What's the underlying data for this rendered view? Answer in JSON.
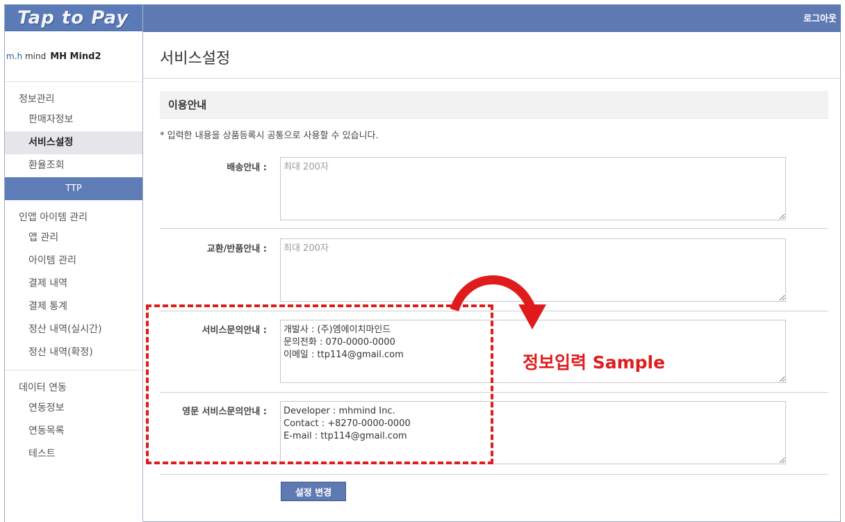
{
  "header": {
    "logo": "Tap to Pay",
    "logout": "로그아웃"
  },
  "company": {
    "logo_prefix": "m.h",
    "logo_word": "mind",
    "name": "MH Mind2"
  },
  "sidebar": {
    "sections": [
      {
        "title": "정보관리",
        "items": [
          "판매자정보",
          "서비스설정",
          "환율조회",
          "TTP"
        ]
      },
      {
        "title": "인앱 아이템 관리",
        "items": [
          "앱 관리",
          "아이템 관리",
          "결제 내역",
          "결제 통계",
          "정산 내역(실시간)",
          "정산 내역(확정)"
        ]
      },
      {
        "title": "데이터 연동",
        "items": [
          "연동정보",
          "연동목록",
          "테스트"
        ]
      }
    ],
    "active_item": "서비스설정"
  },
  "main": {
    "page_title": "서비스설정",
    "section_title": "이용안내",
    "note": "* 입력한 내용을 상품등록시 공통으로 사용할 수 있습니다.",
    "fields": [
      {
        "label": "배송안내 :",
        "placeholder": "최대 200자",
        "value": ""
      },
      {
        "label": "교환/반품안내 :",
        "placeholder": "최대 200자",
        "value": ""
      },
      {
        "label": "서비스문의안내 :",
        "placeholder": "",
        "value": "개발사 : (주)엠에이치마인드\n문의전화 : 070-0000-0000\n이메일 : ttp114@gmail.com"
      },
      {
        "label": "영문 서비스문의안내 :",
        "placeholder": "",
        "value": "Developer : mhmind Inc.\nContact : +8270-0000-0000\nE-mail : ttp114@gmail.com"
      }
    ],
    "submit_label": "설정 변경"
  },
  "annotation": {
    "text": "정보입력  Sample",
    "color": "#e01b1b"
  },
  "colors": {
    "header": "#5f7ab2",
    "active_menu": "#e6e6ea",
    "ttp_menu": "#5e7db6"
  }
}
